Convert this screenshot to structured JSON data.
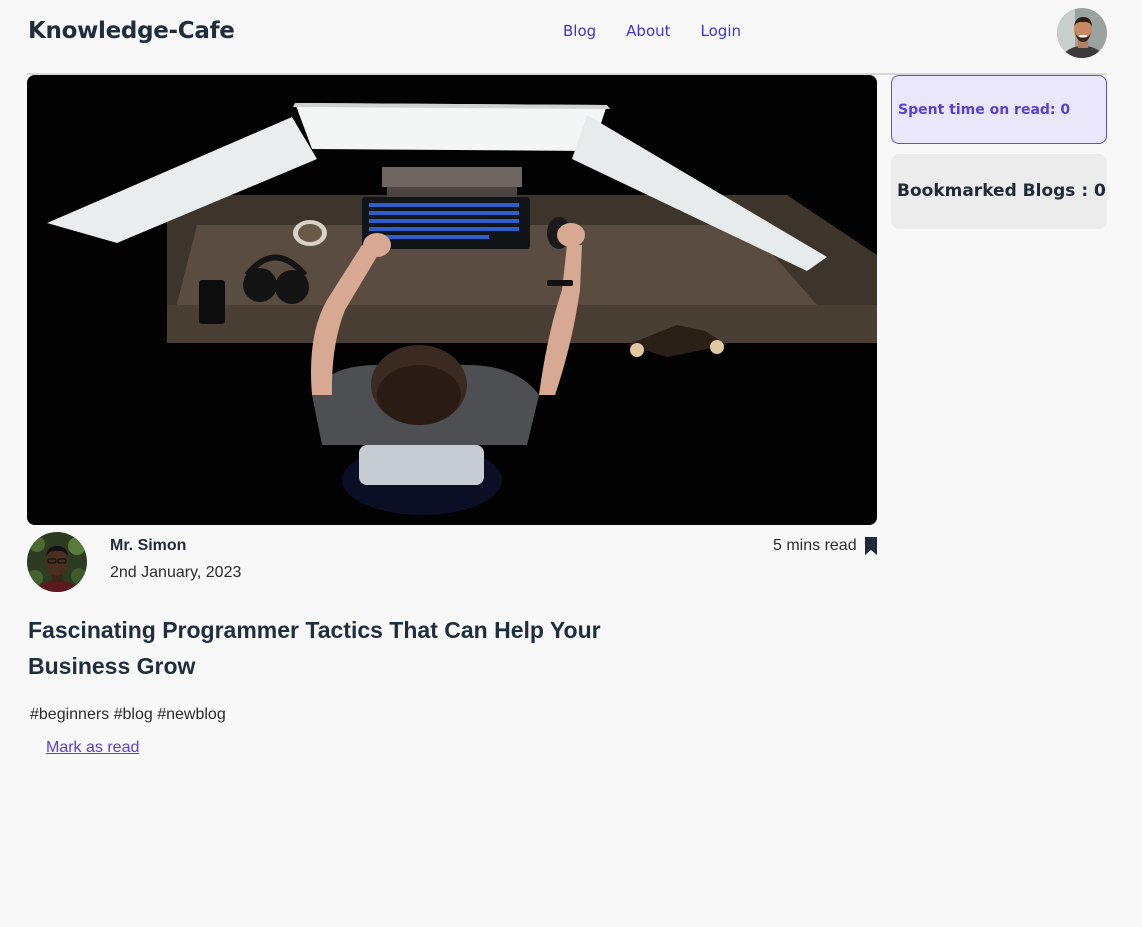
{
  "header": {
    "brand": "Knowledge-Cafe",
    "nav": [
      "Blog",
      "About",
      "Login"
    ]
  },
  "post": {
    "author": "Mr. Simon",
    "date": "2nd January, 2023",
    "read_time": "5 mins read",
    "title": "Fascinating Programmer Tactics That Can Help Your Business Grow",
    "hashtags": "#beginners #blog #newblog",
    "mark_read_label": "Mark as read",
    "hero_icon": "photo-programmer-at-desk"
  },
  "sidebar": {
    "spent_time": "Spent time on read: 0",
    "bookmarked": "Bookmarked Blogs : 0"
  },
  "colors": {
    "background": "#f8f8f8",
    "nav_link": "#3b34d9",
    "accent": "#5a3fd6",
    "spent_bg": "#ebe7fb",
    "bookmark_bg": "#ececec"
  }
}
